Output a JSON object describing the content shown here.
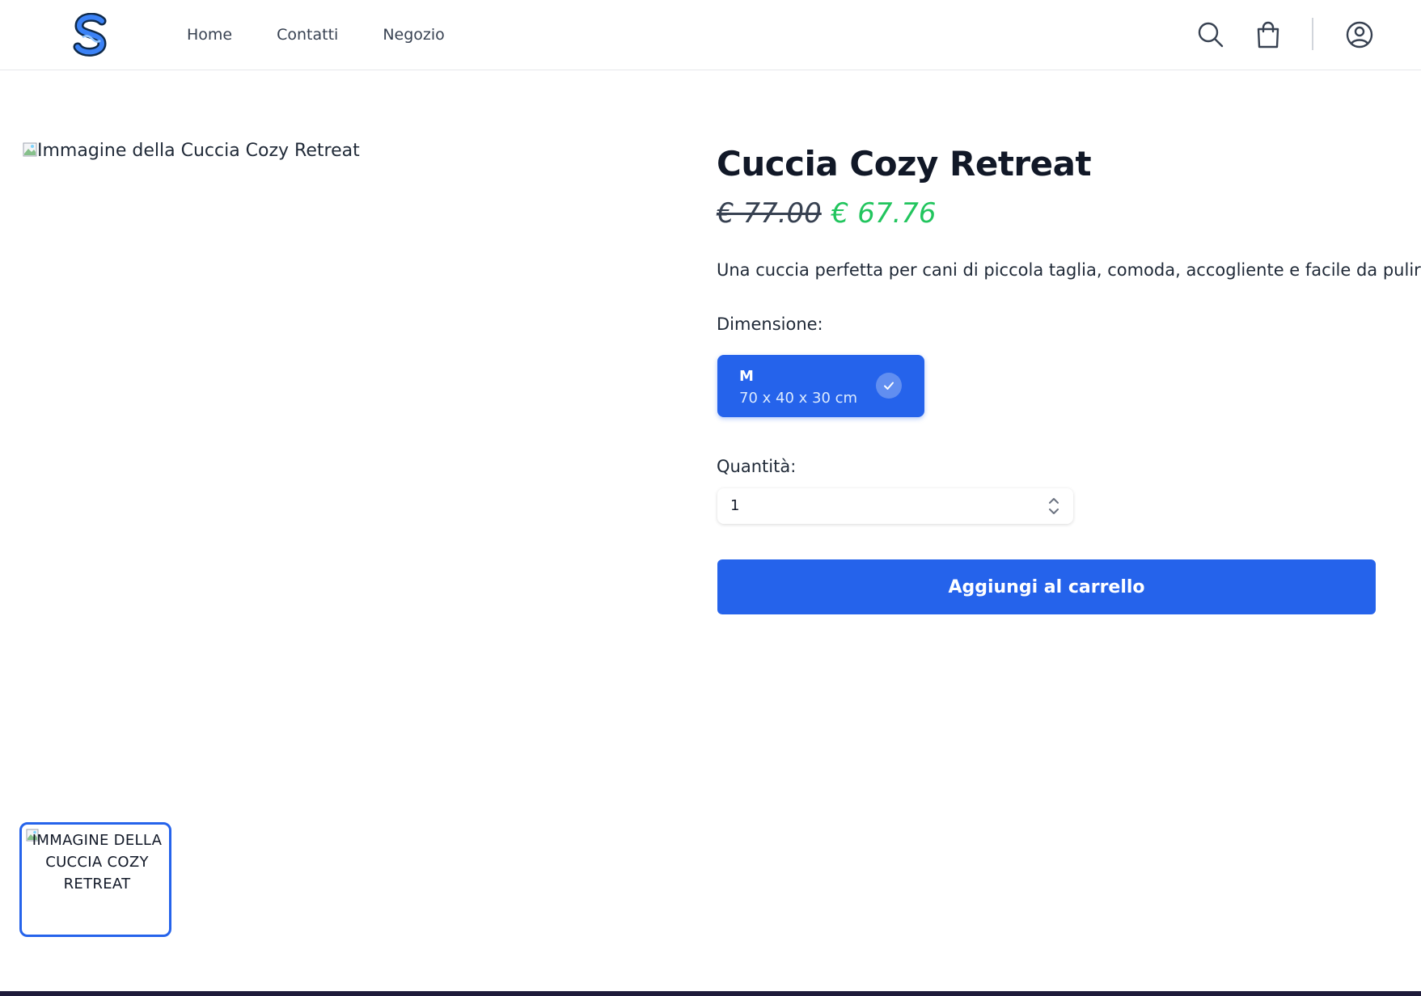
{
  "header": {
    "logo_icon": "s-monogram-logo-icon",
    "nav": [
      {
        "label": "Home"
      },
      {
        "label": "Contatti"
      },
      {
        "label": "Negozio"
      }
    ],
    "icons": [
      "search-icon",
      "shopping-bag-icon",
      "user-account-icon"
    ]
  },
  "product": {
    "image_alt": "Immagine della Cuccia Cozy Retreat",
    "title": "Cuccia Cozy Retreat",
    "old_price": "€ 77.00",
    "price": "€ 67.76",
    "description": "Una cuccia perfetta per cani di piccola taglia, comoda, accogliente e facile da pulire.",
    "dimension_label": "Dimensione:",
    "sizes": [
      {
        "name": "M",
        "dimensions": "70 x 40 x 30 cm",
        "selected": true
      }
    ],
    "quantity_label": "Quantità:",
    "quantity": "1",
    "add_to_cart": "Aggiungi al carrello",
    "thumbnail_alt": "Immagine della Cuccia Cozy Retreat"
  },
  "colors": {
    "primary": "#2563eb",
    "sale_price": "#22c55e",
    "text": "#111827"
  }
}
